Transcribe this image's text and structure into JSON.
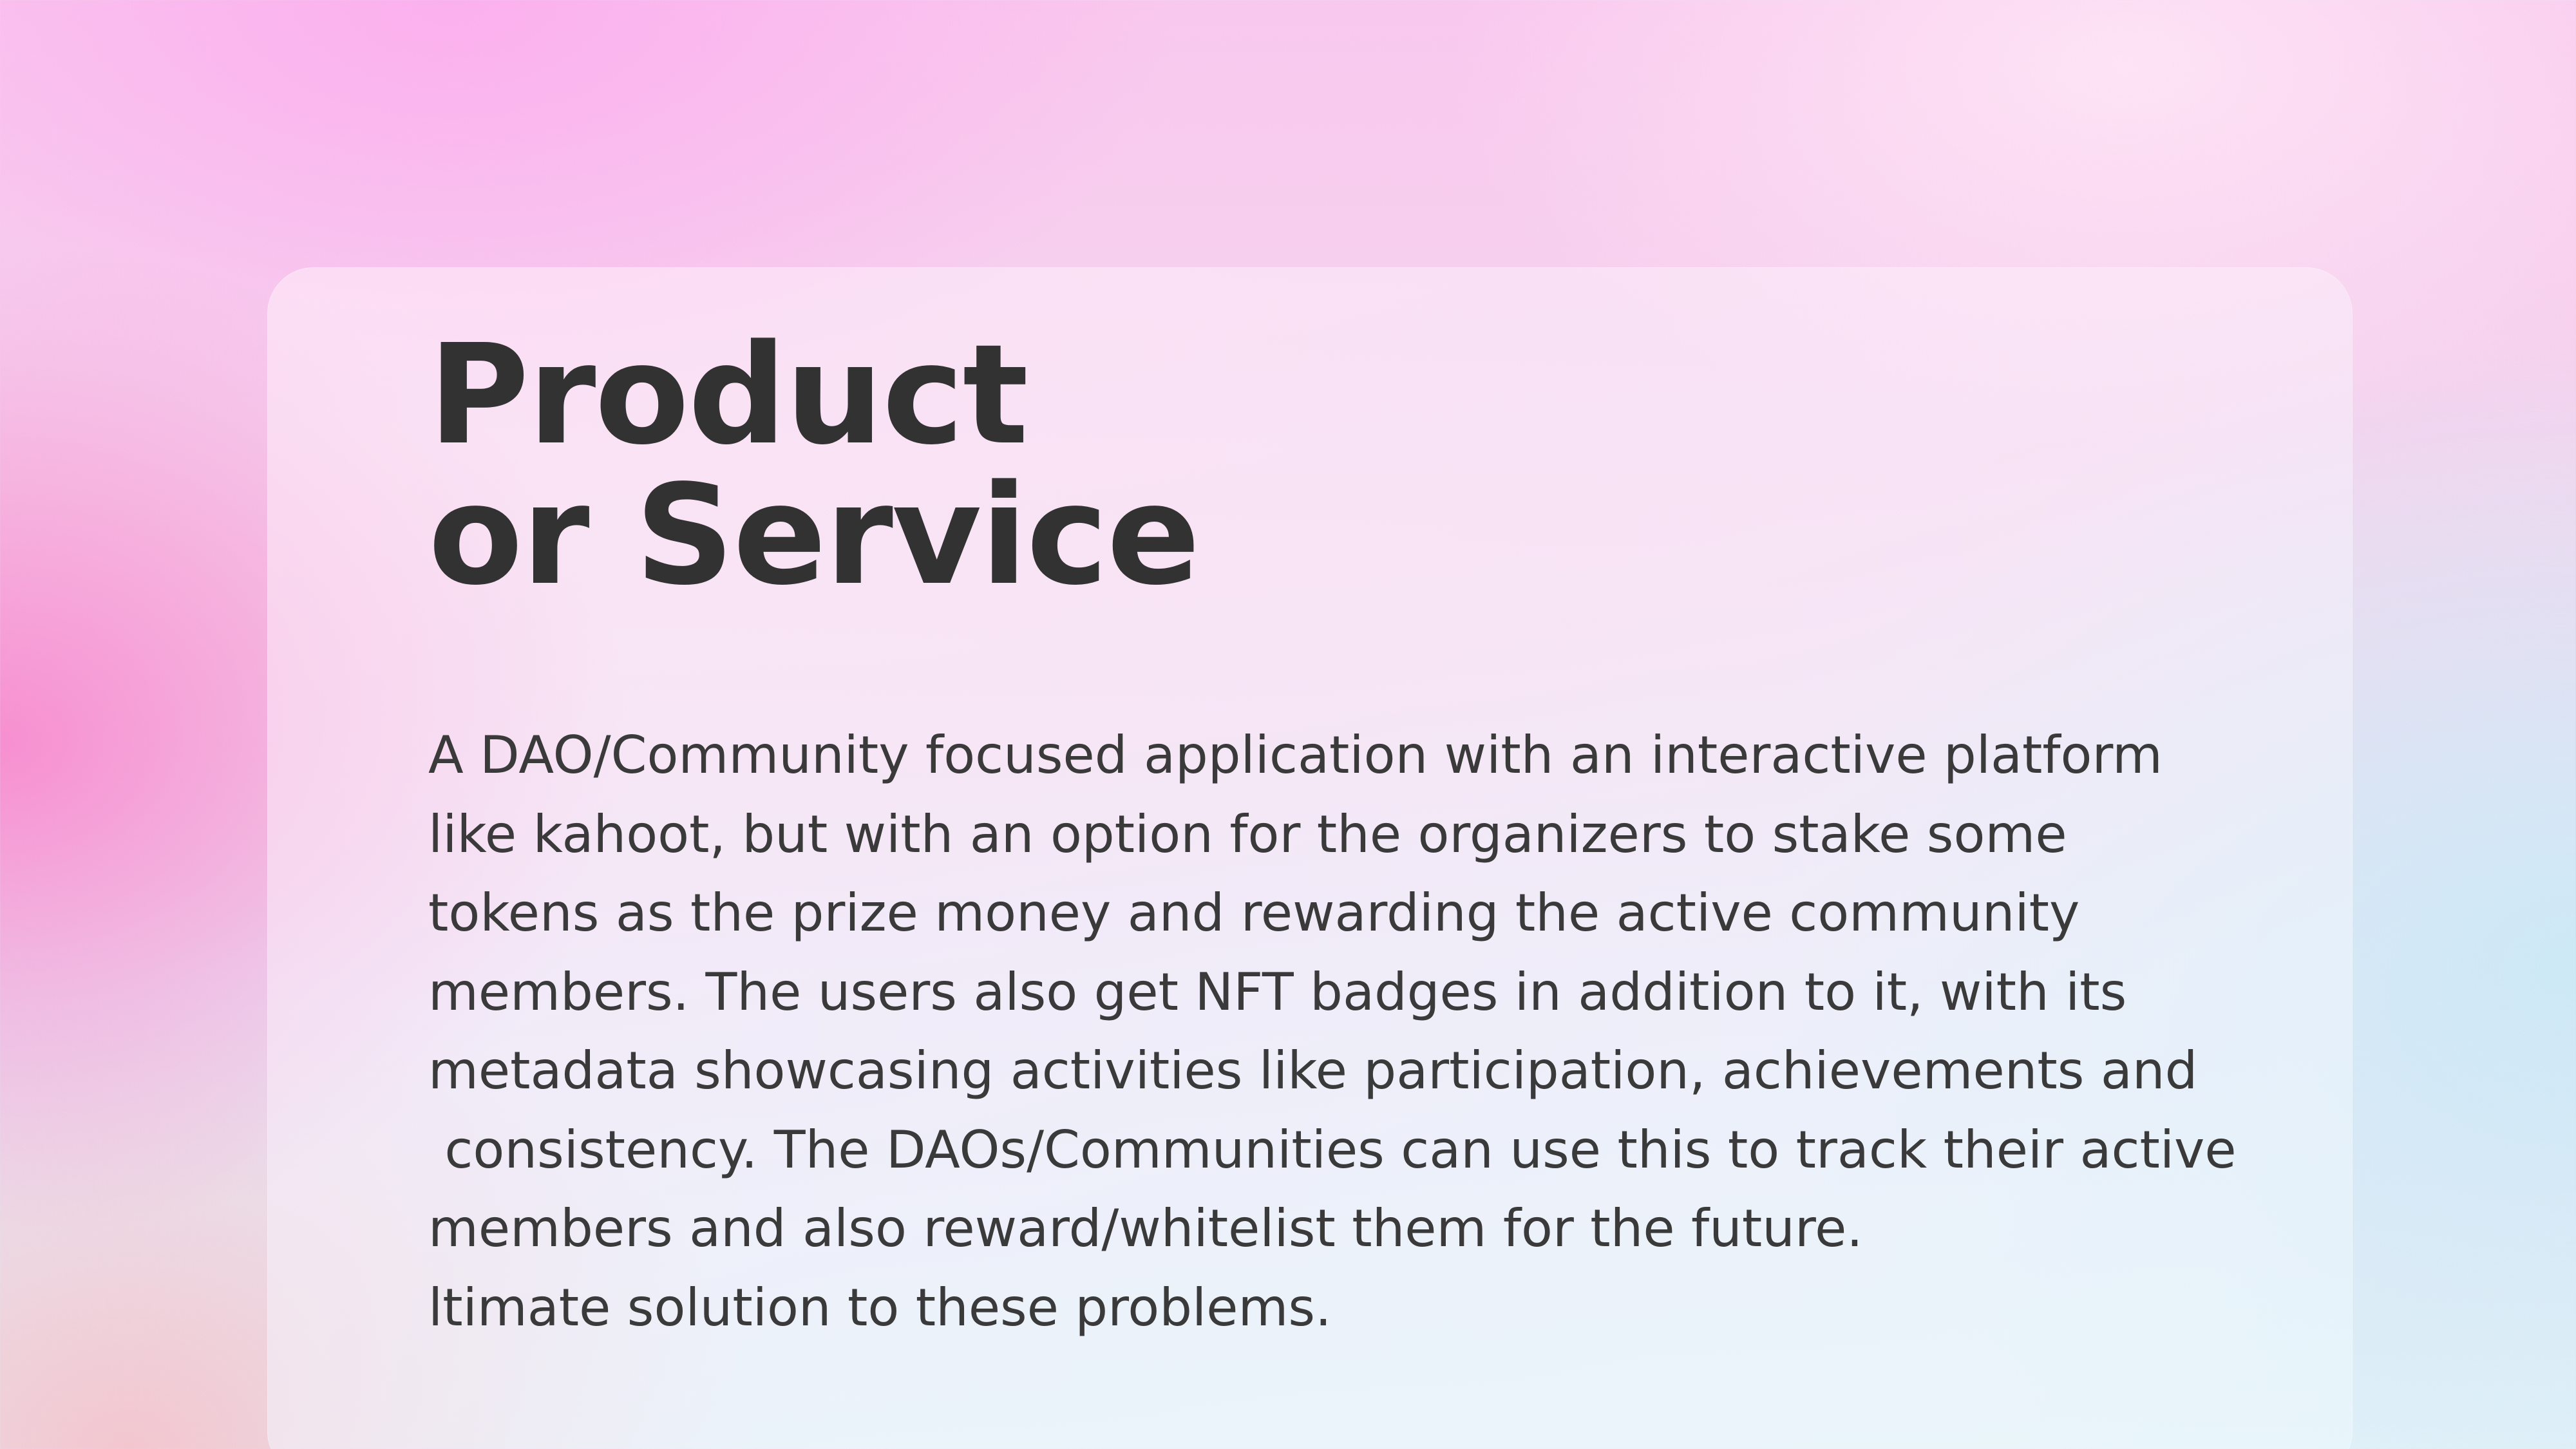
{
  "slide": {
    "title_lines": [
      "Product",
      "or Service"
    ],
    "body_lines": [
      "A DAO/Community focused application with an interactive platform",
      "like kahoot, but with an option for the organizers to stake some",
      "tokens as the prize money and rewarding the active community",
      "members. The users also get NFT badges in addition to it, with its",
      "metadata showcasing activities like participation, achievements and",
      " consistency. The DAOs/Communities can use this to track their active",
      "members and also reward/whitelist them for the future.",
      "ltimate solution to these problems."
    ]
  },
  "colors": {
    "title": "#323232",
    "body_text": "#3a3a3a",
    "background_pink": "#f78fd0",
    "background_blue": "#cde9f6"
  }
}
